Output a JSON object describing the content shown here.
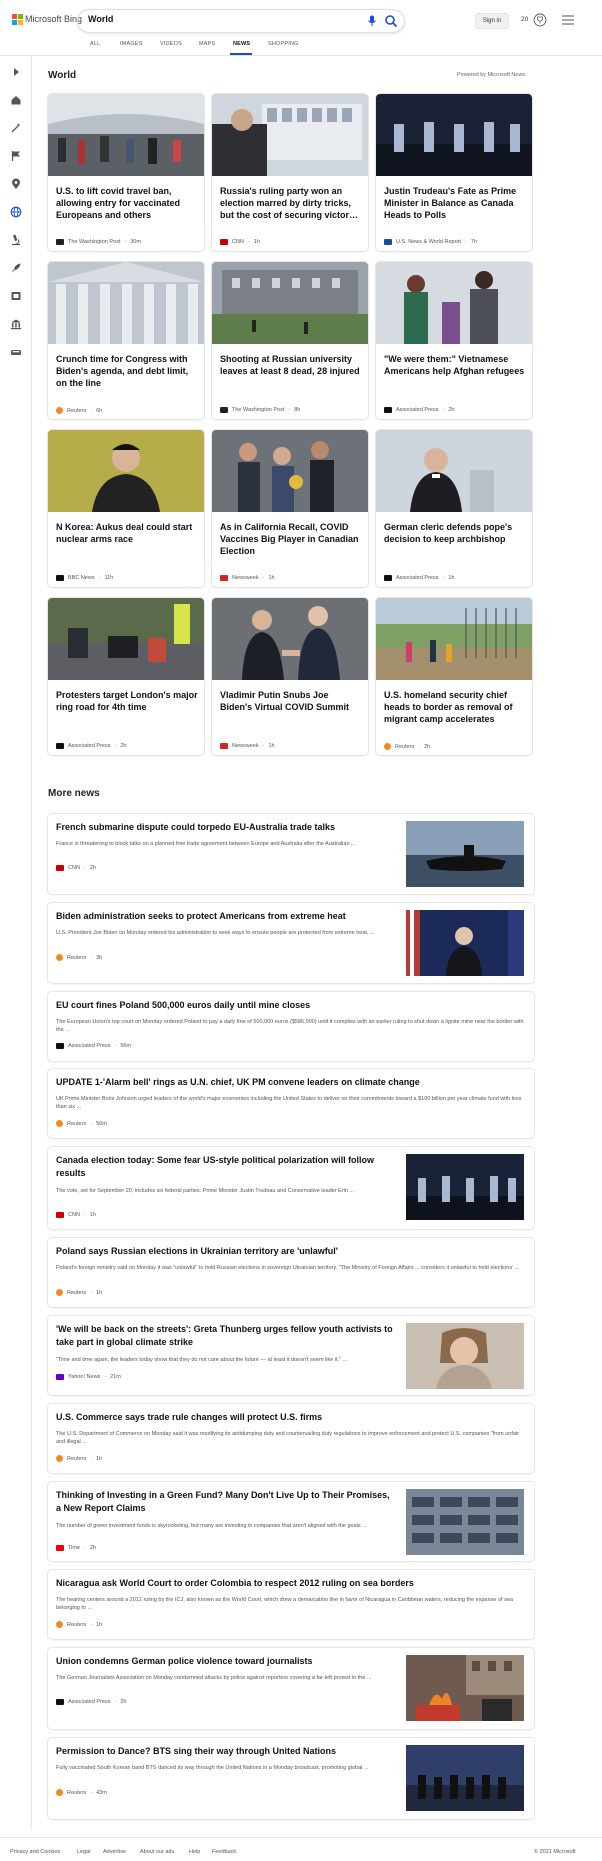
{
  "header": {
    "brand": "Microsoft Bing",
    "query": "World",
    "signin": "Sign in",
    "rewards": "20"
  },
  "tabs": [
    "ALL",
    "IMAGES",
    "VIDEOS",
    "MAPS",
    "NEWS",
    "SHOPPING"
  ],
  "active_tab": "NEWS",
  "rail_icons": [
    "collapse-arrow-icon",
    "home-icon",
    "magic-icon",
    "flag-icon",
    "location-icon",
    "globe-icon",
    "microscope-icon",
    "rocket-icon",
    "film-icon",
    "building-icon",
    "car-icon"
  ],
  "main": {
    "section_title": "World",
    "powered_by": "Powered by Microsoft News"
  },
  "cards": [
    {
      "title": "U.S. to lift covid travel ban, allowing entry for vaccinated Europeans and others",
      "source": "The Washington Post",
      "age": "30m",
      "logo_color": "#222222"
    },
    {
      "title": "Russia's ruling party won an election marred by dirty tricks, but the cost of securing victor…",
      "source": "CNN",
      "age": "1h",
      "logo_color": "#cc0000"
    },
    {
      "title": "Justin Trudeau's Fate as Prime Minister in Balance as Canada Heads to Polls",
      "source": "U.S. News & World Report",
      "age": "7h",
      "logo_color": "#1a4aa0"
    },
    {
      "title": "Crunch time for Congress with Biden's agenda, and debt limit, on the line",
      "source": "Reuters",
      "age": "6h",
      "logo_color": "#f08a24"
    },
    {
      "title": "Shooting at Russian university leaves at least 8 dead, 28 injured",
      "source": "The Washington Post",
      "age": "8h",
      "logo_color": "#222222"
    },
    {
      "title": "\"We were them:\" Vietnamese Americans help Afghan refugees",
      "source": "Associated Press",
      "age": "2h",
      "logo_color": "#111111"
    },
    {
      "title": "N Korea: Aukus deal could start nuclear arms race",
      "source": "BBC News",
      "age": "11h",
      "logo_color": "#111111"
    },
    {
      "title": "As in California Recall, COVID Vaccines Big Player in Canadian Election",
      "source": "Newsweek",
      "age": "1h",
      "logo_color": "#d3232a"
    },
    {
      "title": "German cleric defends pope's decision to keep archbishop",
      "source": "Associated Press",
      "age": "1h",
      "logo_color": "#111111"
    },
    {
      "title": "Protesters target London's major ring road for 4th time",
      "source": "Associated Press",
      "age": "2h",
      "logo_color": "#111111"
    },
    {
      "title": "Vladimir Putin Snubs Joe Biden's Virtual COVID Summit",
      "source": "Newsweek",
      "age": "1h",
      "logo_color": "#d3232a"
    },
    {
      "title": "U.S. homeland security chief heads to border as removal of migrant camp accelerates",
      "source": "Reuters",
      "age": "2h",
      "logo_color": "#f08a24"
    }
  ],
  "more_news_title": "More news",
  "more_news": [
    {
      "title": "French submarine dispute could torpedo EU-Australia trade talks",
      "snippet": "France is threatening to block talks on a planned free trade agreement between Europe and Australia after the Australian ...",
      "source": "CNN",
      "age": "2h",
      "logo_color": "#cc0000",
      "has_image": true
    },
    {
      "title": "Biden administration seeks to protect Americans from extreme heat",
      "snippet": "U.S. President Joe Biden on Monday ordered his administration to seek ways to ensure people are protected from extreme heat, ...",
      "source": "Reuters",
      "age": "3h",
      "logo_color": "#f08a24",
      "has_image": true
    },
    {
      "title": "EU court fines Poland 500,000 euros daily until mine closes",
      "snippet": "The European Union's top court on Monday ordered Poland to pay a daily fine of 500,000 euros ($586,000) until it complies with an earlier ruling to shut down a lignite mine near the border with the ...",
      "source": "Associated Press",
      "age": "56m",
      "logo_color": "#111111",
      "has_image": false
    },
    {
      "title": "UPDATE 1-'Alarm bell' rings as U.N. chief, UK PM convene leaders on climate change",
      "snippet": "UK Prime Minister Boris Johnson urged leaders of the world's major economies including the United States to deliver on their commitments toward a $100 billion per year climate fund with less than six ...",
      "source": "Reuters",
      "age": "50m",
      "logo_color": "#f08a24",
      "has_image": false
    },
    {
      "title": "Canada election today: Some fear US-style political polarization will follow results",
      "snippet": "The vote, set for September 20, includes six federal parties. Prime Minister Justin Trudeau and Conservative leader Erin ...",
      "source": "CNN",
      "age": "1h",
      "logo_color": "#cc0000",
      "has_image": true
    },
    {
      "title": "Poland says Russian elections in Ukrainian territory are 'unlawful'",
      "snippet": "Poland's foreign ministry said on Monday it was \"unlawful\" to hold Russian elections in sovereign Ukrainian territory. \"The Ministry of Foreign Affairs ... considers it unlawful to hold elections' ...",
      "source": "Reuters",
      "age": "1h",
      "logo_color": "#f08a24",
      "has_image": false
    },
    {
      "title": "'We will be back on the streets': Greta Thunberg urges fellow youth activists to take part in global climate strike",
      "snippet": "\"Time and time again, the leaders today show that they do not care about the future — at least it doesn't seem like it,\" ...",
      "source": "Yahoo! News",
      "age": "21m",
      "logo_color": "#6001d2",
      "has_image": true
    },
    {
      "title": "U.S. Commerce says trade rule changes will protect U.S. firms",
      "snippet": "The U.S. Department of Commerce on Monday said it was modifying its antidumping duty and countervailing duty regulations to improve enforcement and protect U.S. companies \"from unfair and illegal ...",
      "source": "Reuters",
      "age": "1h",
      "logo_color": "#f08a24",
      "has_image": false
    },
    {
      "title": "Thinking of Investing in a Green Fund? Many Don't Live Up to Their Promises, a New Report Claims",
      "snippet": "The number of green investment funds is skyrocketing, but many are investing in companies that aren't aligned with the goals ...",
      "source": "Time",
      "age": "2h",
      "logo_color": "#e90606",
      "has_image": true
    },
    {
      "title": "Nicaragua ask World Court to order Colombia to respect 2012 ruling on sea borders",
      "snippet": "The hearing centers around a 2012 ruling by the ICJ, also known as the World Court, which drew a demarcation line in favor of Nicaragua in Caribbean waters, reducing the expanse of sea belonging to ...",
      "source": "Reuters",
      "age": "1h",
      "logo_color": "#f08a24",
      "has_image": false
    },
    {
      "title": "Union condemns German police violence toward journalists",
      "snippet": "The German Journalists Association on Monday condemned attacks by police against reporters covering a far-left protest in the ...",
      "source": "Associated Press",
      "age": "2h",
      "logo_color": "#111111",
      "has_image": true
    },
    {
      "title": "Permission to Dance? BTS sing their way through United Nations",
      "snippet": "Fully vaccinated South Korean band BTS danced its way through the United Nations in a Monday broadcast, promoting global ...",
      "source": "Reuters",
      "age": "43m",
      "logo_color": "#f08a24",
      "has_image": true
    }
  ],
  "footer": {
    "links": [
      "Privacy and Cookies",
      "Legal",
      "Advertise",
      "About our ads",
      "Help",
      "Feedback"
    ],
    "copyright": "© 2021 Microsoft"
  }
}
